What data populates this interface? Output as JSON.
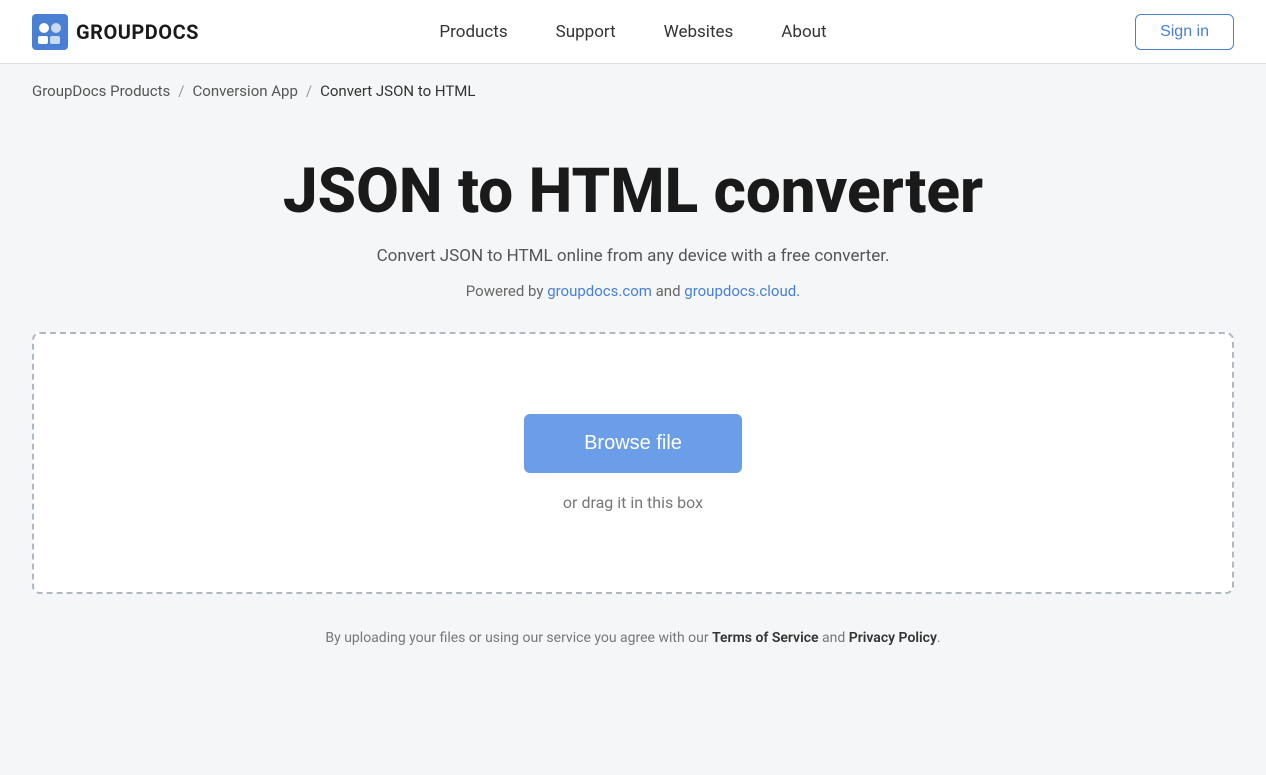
{
  "header": {
    "logo_text": "GROUPDOCS",
    "nav": {
      "items": [
        {
          "label": "Products",
          "id": "products"
        },
        {
          "label": "Support",
          "id": "support"
        },
        {
          "label": "Websites",
          "id": "websites"
        },
        {
          "label": "About",
          "id": "about"
        }
      ]
    },
    "sign_in_label": "Sign in"
  },
  "breadcrumb": {
    "items": [
      {
        "label": "GroupDocs Products",
        "id": "groupdocs-products"
      },
      {
        "label": "Conversion App",
        "id": "conversion-app"
      }
    ],
    "current": "Convert JSON to HTML",
    "separator": "/"
  },
  "main": {
    "title": "JSON to HTML converter",
    "subtitle": "Convert JSON to HTML online from any device with a free converter.",
    "powered_by_prefix": "Powered by ",
    "powered_by_link1_text": "groupdocs.com",
    "powered_by_link1_href": "https://groupdocs.com",
    "powered_by_middle": " and ",
    "powered_by_link2_text": "groupdocs.cloud",
    "powered_by_link2_href": "https://groupdocs.cloud",
    "powered_by_suffix": ".",
    "dropzone": {
      "browse_label": "Browse file",
      "drag_hint": "or drag it in this box"
    },
    "footer_note_prefix": "By uploading your files or using our service you agree with our ",
    "terms_label": "Terms of Service",
    "footer_and": " and ",
    "privacy_label": "Privacy Policy",
    "footer_note_suffix": "."
  },
  "colors": {
    "accent": "#4a80d4",
    "browse_btn": "#6b9de8",
    "border": "#b0b8c4"
  }
}
